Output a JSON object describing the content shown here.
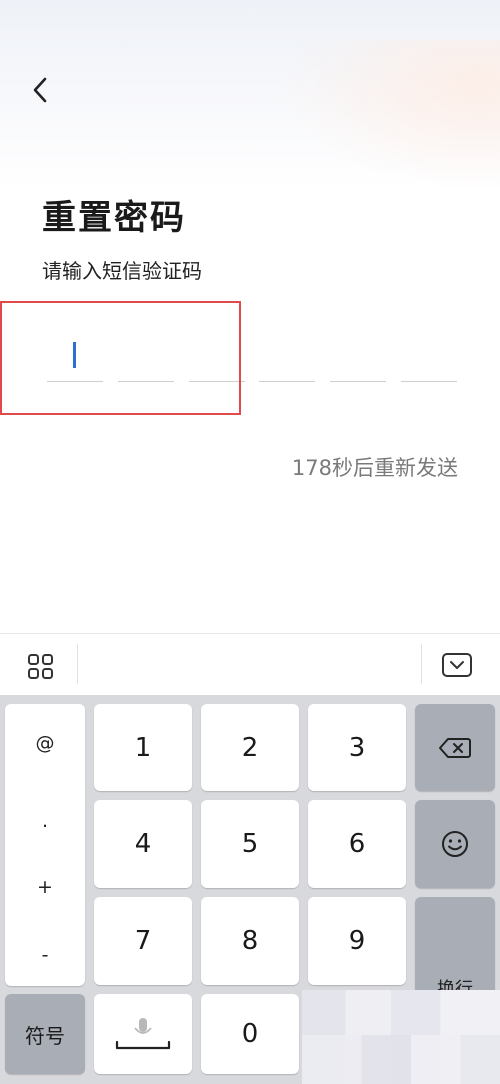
{
  "header": {
    "back_icon": "chevron-left-icon"
  },
  "page": {
    "title": "重置密码",
    "subtitle": "请输入短信验证码",
    "resend_text": "178秒后重新发送",
    "code_length": 6
  },
  "colors": {
    "caret": "#2b6fd6",
    "highlight_box": "#e04a4a",
    "keyboard_bg": "#d8d9dd",
    "function_key": "#a9adb6"
  },
  "toolbar": {
    "menu_icon": "grid-four-icon",
    "hide_keyboard_icon": "keyboard-collapse-icon"
  },
  "keyboard": {
    "symbols": [
      "@",
      ".",
      "+",
      "-"
    ],
    "digits": [
      "1",
      "2",
      "3",
      "4",
      "5",
      "6",
      "7",
      "8",
      "9",
      "0"
    ],
    "delete_icon": "backspace-icon",
    "emoji_icon": "smiley-icon",
    "enter_label": "换行",
    "symbols_key_label": "符号",
    "space_icon": "microphone-space-icon"
  }
}
